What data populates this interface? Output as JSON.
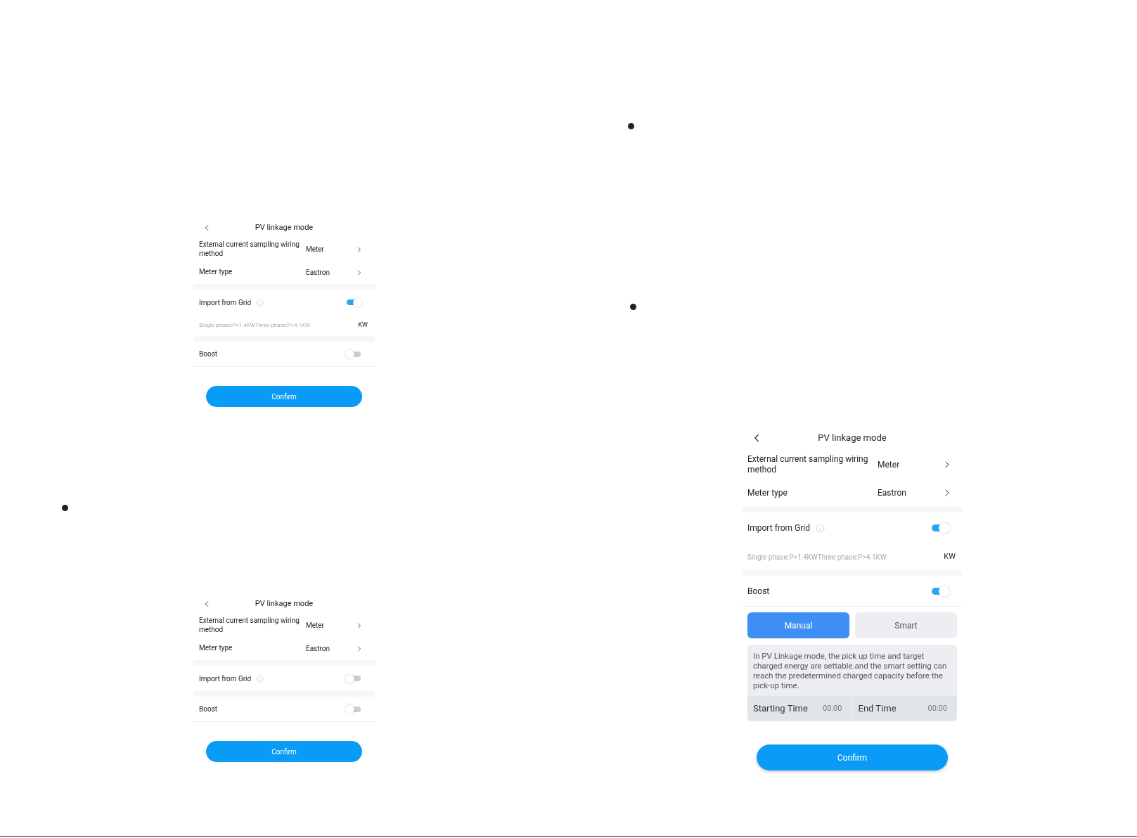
{
  "screens": [
    {
      "title": "PV linkage mode",
      "rows": [
        {
          "label": "External current sampling wiring method",
          "value": "Meter"
        },
        {
          "label": "Meter type",
          "value": "Eastron"
        }
      ],
      "import_from_grid": {
        "label": "Import from Grid",
        "on": true
      },
      "threshold": {
        "text": "Single phase:P>1.4KWThree phase:P>4.1KW",
        "unit": "KW"
      },
      "boost": {
        "label": "Boost",
        "on": false
      },
      "confirm": "Confirm"
    },
    {
      "title": "PV linkage mode",
      "rows": [
        {
          "label": "External current sampling wiring method",
          "value": "Meter"
        },
        {
          "label": "Meter type",
          "value": "Eastron"
        }
      ],
      "import_from_grid": {
        "label": "Import from Grid",
        "on": false
      },
      "boost": {
        "label": "Boost",
        "on": false
      },
      "confirm": "Confirm"
    },
    {
      "title": "PV linkage mode",
      "rows": [
        {
          "label": "External current sampling wiring method",
          "value": "Meter"
        },
        {
          "label": "Meter type",
          "value": "Eastron"
        }
      ],
      "import_from_grid": {
        "label": "Import from Grid",
        "on": true
      },
      "threshold": {
        "text": "Single phase:P>1.4KWThree phase:P>4.1KW",
        "unit": "KW"
      },
      "boost": {
        "label": "Boost",
        "on": true
      },
      "modes": [
        {
          "label": "Manual",
          "selected": true
        },
        {
          "label": "Smart",
          "selected": false
        }
      ],
      "description": "In PV Linkage mode, the pick up time and target charged energy are settable.and the smart setting can reach the predetermined charged capacity before the pick-up time.",
      "times": [
        {
          "label": "Starting Time",
          "value": "00:00"
        },
        {
          "label": "End Time",
          "value": "00:00"
        }
      ],
      "confirm": "Confirm"
    }
  ]
}
